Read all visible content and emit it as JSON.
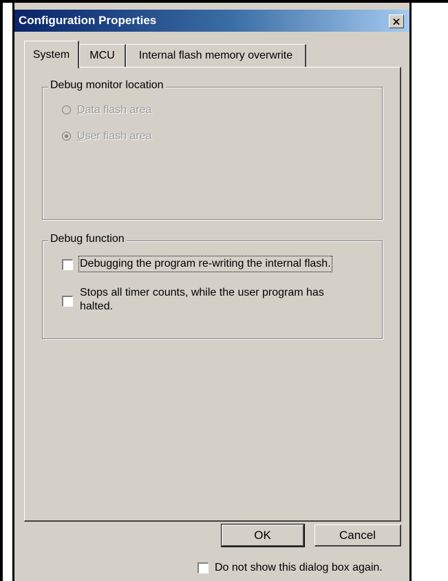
{
  "window": {
    "title": "Configuration Properties"
  },
  "tabs": [
    {
      "label": "System",
      "active": true
    },
    {
      "label": "MCU",
      "active": false
    },
    {
      "label": "Internal flash memory overwrite",
      "active": false
    }
  ],
  "debug_monitor": {
    "legend": "Debug monitor location",
    "options": [
      {
        "access_key": "D",
        "rest": "ata flash area",
        "checked": false,
        "enabled": false
      },
      {
        "access_key": "U",
        "rest": "ser flash area",
        "checked": true,
        "enabled": false
      }
    ]
  },
  "debug_function": {
    "legend": "Debug function",
    "options": [
      {
        "label": "Debugging the program re-writing the internal flash.",
        "checked": false
      },
      {
        "label": "Stops all timer counts, while the user program has halted.",
        "checked": false
      }
    ]
  },
  "buttons": {
    "ok": "OK",
    "cancel": "Cancel"
  },
  "footer": {
    "dont_show_label": "Do not show this dialog box again.",
    "dont_show_checked": false
  },
  "icons": {
    "close": "close-icon"
  }
}
